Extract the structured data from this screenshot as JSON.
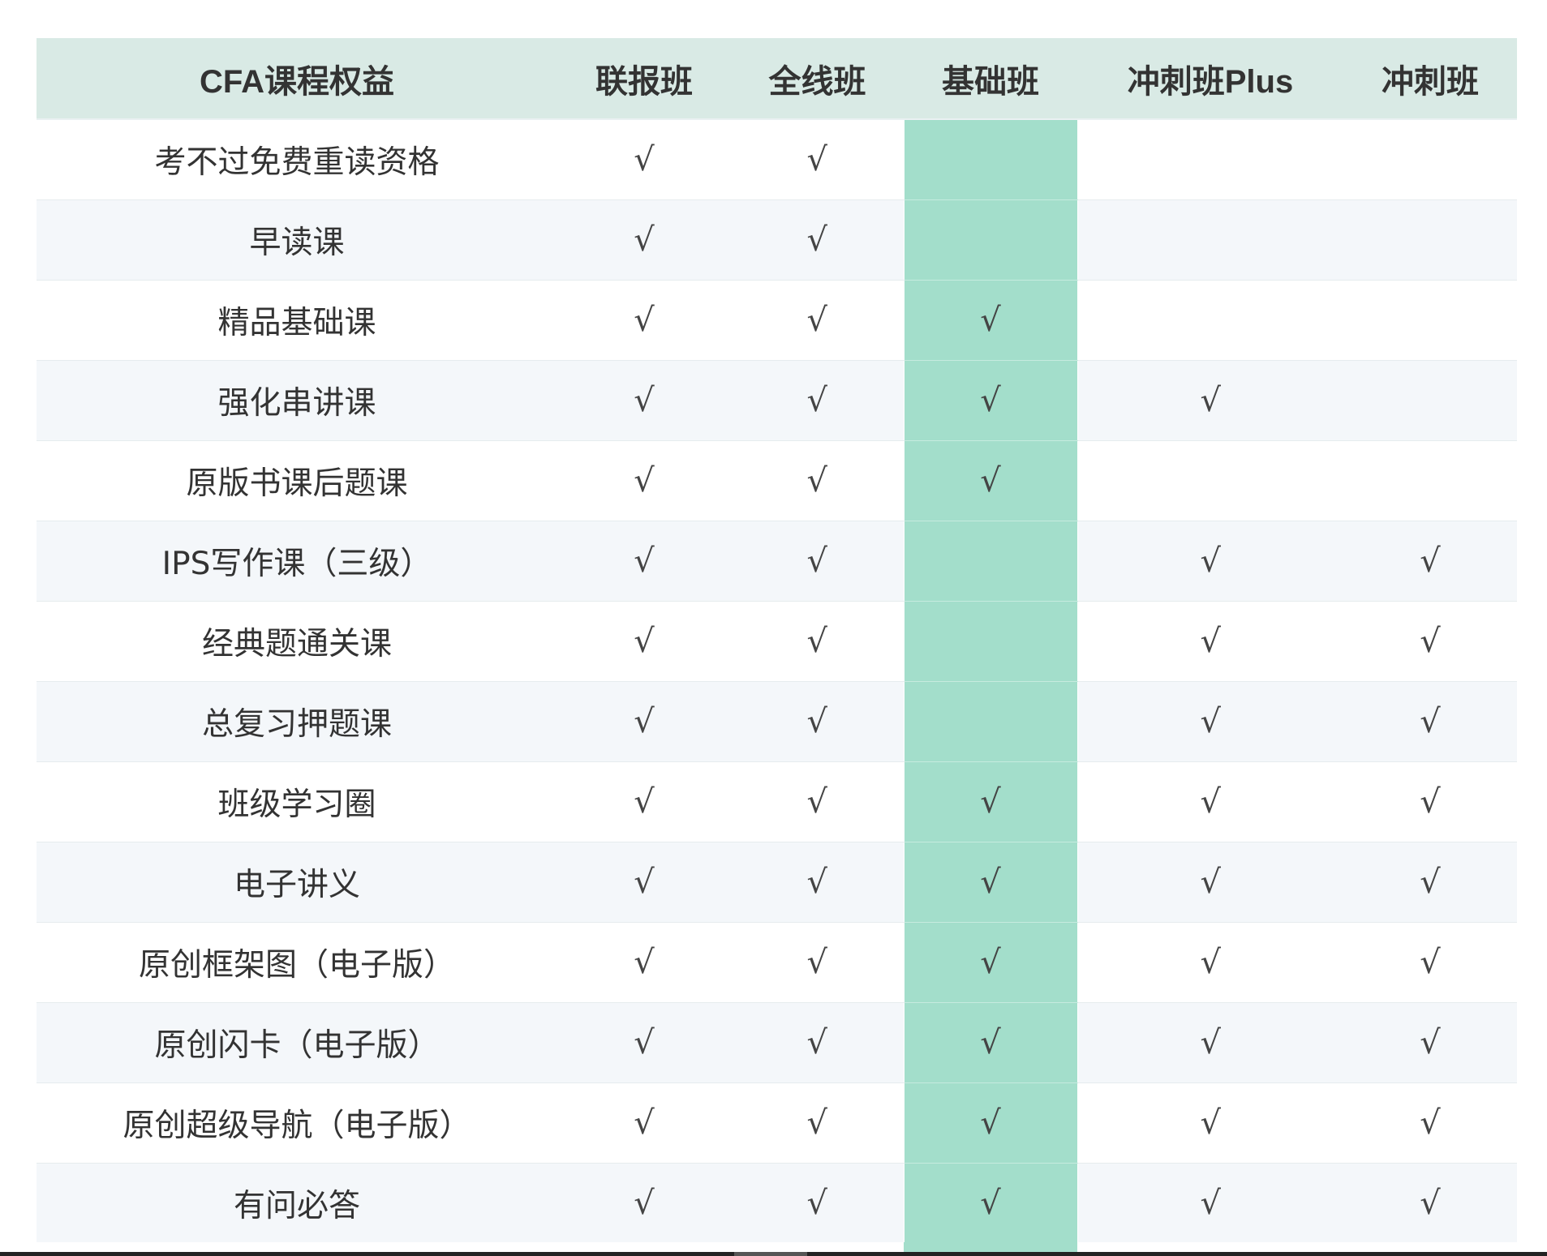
{
  "table": {
    "headers": [
      "CFA课程权益",
      "联报班",
      "全线班",
      "基础班",
      "冲刺班Plus",
      "冲刺班"
    ],
    "highlight_color": "#a3decb",
    "header_bg": "#d9eae5",
    "check_symbol": "√",
    "rows": [
      {
        "feature": "考不过免费重读资格",
        "marks": [
          "√",
          "√",
          "",
          "",
          ""
        ]
      },
      {
        "feature": "早读课",
        "marks": [
          "√",
          "√",
          "",
          "",
          ""
        ]
      },
      {
        "feature": "精品基础课",
        "marks": [
          "√",
          "√",
          "√",
          "",
          ""
        ]
      },
      {
        "feature": "强化串讲课",
        "marks": [
          "√",
          "√",
          "√",
          "√",
          ""
        ]
      },
      {
        "feature": "原版书课后题课",
        "marks": [
          "√",
          "√",
          "√",
          "",
          ""
        ]
      },
      {
        "feature": "IPS写作课（三级）",
        "marks": [
          "√",
          "√",
          "",
          "√",
          "√"
        ]
      },
      {
        "feature": "经典题通关课",
        "marks": [
          "√",
          "√",
          "",
          "√",
          "√"
        ]
      },
      {
        "feature": "总复习押题课",
        "marks": [
          "√",
          "√",
          "",
          "√",
          "√"
        ]
      },
      {
        "feature": "班级学习圈",
        "marks": [
          "√",
          "√",
          "√",
          "√",
          "√"
        ]
      },
      {
        "feature": "电子讲义",
        "marks": [
          "√",
          "√",
          "√",
          "√",
          "√"
        ]
      },
      {
        "feature": "原创框架图（电子版）",
        "marks": [
          "√",
          "√",
          "√",
          "√",
          "√"
        ]
      },
      {
        "feature": "原创闪卡（电子版）",
        "marks": [
          "√",
          "√",
          "√",
          "√",
          "√"
        ]
      },
      {
        "feature": "原创超级导航（电子版）",
        "marks": [
          "√",
          "√",
          "√",
          "√",
          "√"
        ]
      },
      {
        "feature": "有问必答",
        "marks": [
          "√",
          "√",
          "√",
          "√",
          "√"
        ]
      }
    ]
  }
}
